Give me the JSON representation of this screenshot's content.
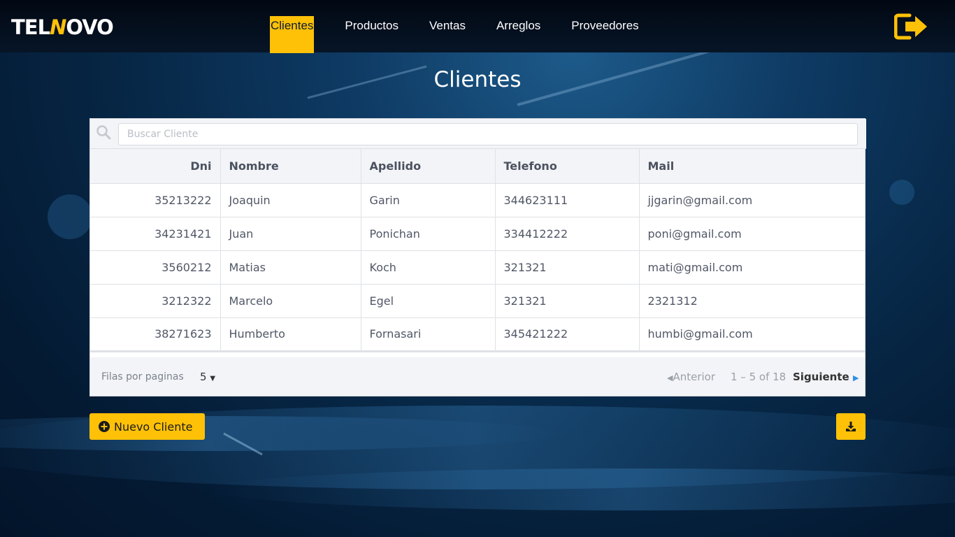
{
  "brand": {
    "logo_left": "TEL",
    "logo_mid": "N",
    "logo_right": "OVO"
  },
  "nav": {
    "items": [
      {
        "label": "Clientes",
        "active": true
      },
      {
        "label": "Productos"
      },
      {
        "label": "Ventas"
      },
      {
        "label": "Arreglos"
      },
      {
        "label": "Proveedores"
      }
    ],
    "logout_icon": "logout-arrow-icon"
  },
  "page": {
    "title": "Clientes"
  },
  "search": {
    "placeholder": "Buscar Cliente",
    "value": ""
  },
  "table": {
    "columns": [
      "Dni",
      "Nombre",
      "Apellido",
      "Telefono",
      "Mail"
    ],
    "rows": [
      [
        "35213222",
        "Joaquin",
        "Garin",
        "344623111",
        "jjgarin@gmail.com"
      ],
      [
        "34231421",
        "Juan",
        "Ponichan",
        "334412222",
        "poni@gmail.com"
      ],
      [
        "3560212",
        "Matias",
        "Koch",
        "321321",
        "mati@gmail.com"
      ],
      [
        "3212322",
        "Marcelo",
        "Egel",
        "321321",
        "2321312"
      ],
      [
        "38271623",
        "Humberto",
        "Fornasari",
        "345421222",
        "humbi@gmail.com"
      ]
    ]
  },
  "pagination": {
    "rows_label": "Filas por paginas",
    "rows_value": "5",
    "prev_label": "Anterior",
    "range_text": "1 – 5 of 18",
    "next_label": "Siguiente"
  },
  "actions": {
    "new_label": "Nuevo Cliente",
    "download_icon": "download-icon"
  },
  "colors": {
    "accent": "#ffc107",
    "navbar": "#061527",
    "link": "#2d8fe6"
  }
}
